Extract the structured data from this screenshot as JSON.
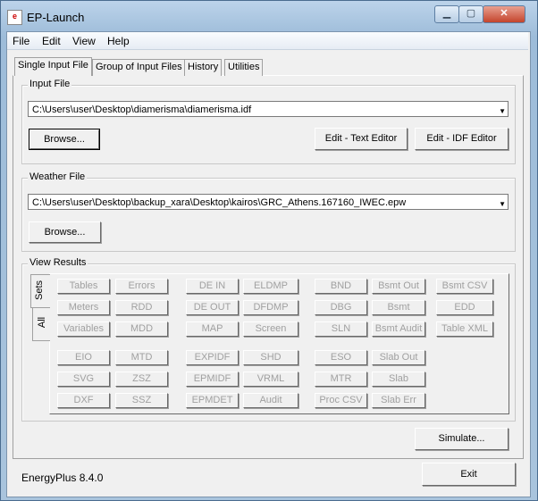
{
  "window": {
    "title": "EP-Launch",
    "app_icon": "ep-launch-icon",
    "controls": [
      "minimize",
      "maximize",
      "close"
    ]
  },
  "menu": [
    "File",
    "Edit",
    "View",
    "Help"
  ],
  "tabs": [
    "Single Input File",
    "Group of Input Files",
    "History",
    "Utilities"
  ],
  "input_file": {
    "label": "Input File",
    "value": "C:\\Users\\user\\Desktop\\diamerisma\\diamerisma.idf",
    "browse": "Browse...",
    "edit_text": "Edit - Text Editor",
    "edit_idf": "Edit - IDF Editor"
  },
  "weather_file": {
    "label": "Weather File",
    "value": "C:\\Users\\user\\Desktop\\backup_xara\\Desktop\\kairos\\GRC_Athens.167160_IWEC.epw",
    "browse": "Browse..."
  },
  "view_results": {
    "label": "View Results",
    "side_tabs": [
      "Sets",
      "All"
    ],
    "rows": [
      [
        "Tables",
        "Errors",
        "DE IN",
        "ELDMP",
        "BND",
        "Bsmt Out",
        "Bsmt CSV"
      ],
      [
        "Meters",
        "RDD",
        "DE OUT",
        "DFDMP",
        "DBG",
        "Bsmt",
        "EDD"
      ],
      [
        "Variables",
        "MDD",
        "MAP",
        "Screen",
        "SLN",
        "Bsmt Audit",
        "Table XML"
      ],
      [
        "EIO",
        "MTD",
        "EXPIDF",
        "SHD",
        "ESO",
        "Slab Out",
        ""
      ],
      [
        "SVG",
        "ZSZ",
        "EPMIDF",
        "VRML",
        "MTR",
        "Slab",
        ""
      ],
      [
        "DXF",
        "SSZ",
        "EPMDET",
        "Audit",
        "Proc CSV",
        "Slab Err",
        ""
      ]
    ]
  },
  "simulate": "Simulate...",
  "exit": "Exit",
  "version": "EnergyPlus 8.4.0"
}
